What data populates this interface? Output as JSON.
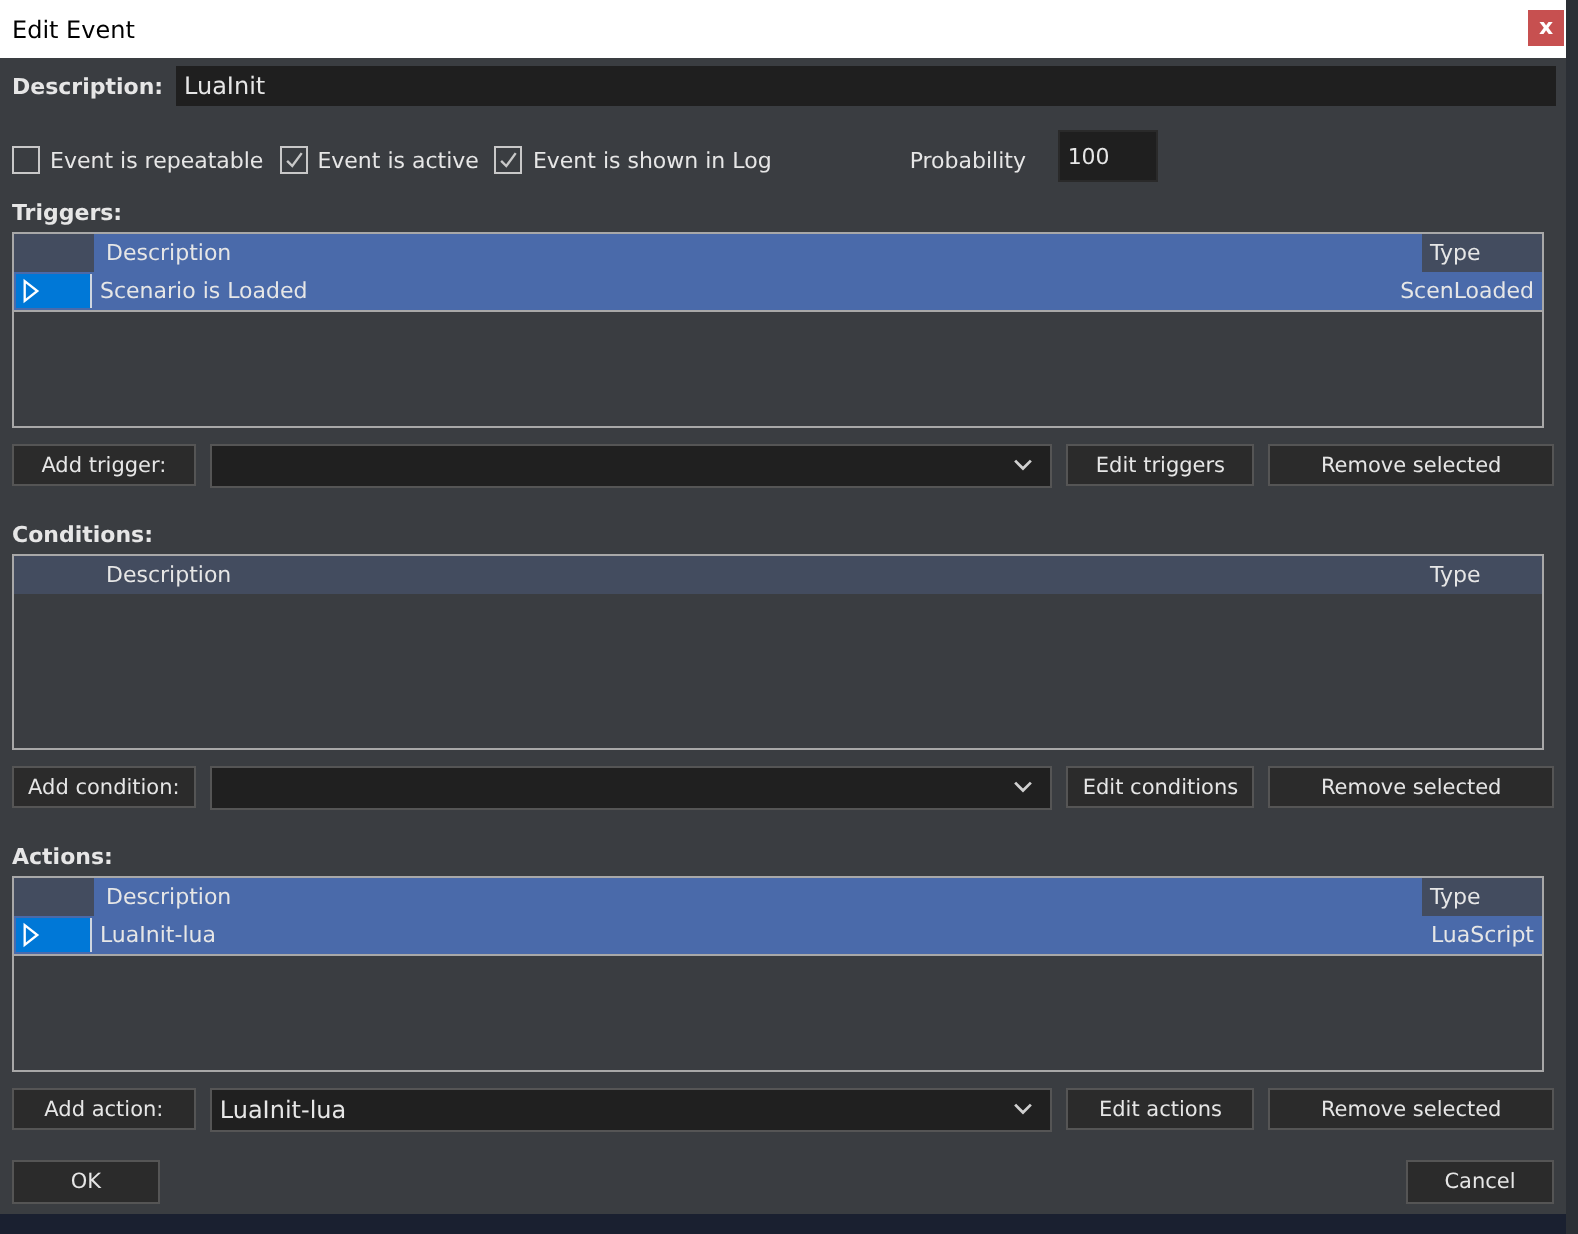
{
  "window": {
    "title": "Edit Event",
    "close_label": "x"
  },
  "description": {
    "label": "Description:",
    "value": "LuaInit"
  },
  "options": [
    {
      "label": "Event is repeatable",
      "checked": false
    },
    {
      "label": "Event is active",
      "checked": true
    },
    {
      "label": "Event is shown in Log",
      "checked": true
    }
  ],
  "probability": {
    "label": "Probability",
    "value": "100"
  },
  "sections": [
    {
      "label": "Triggers:",
      "columns": [
        "Description",
        "Type"
      ],
      "header_selected": true,
      "rows": [
        {
          "description": "Scenario is Loaded",
          "type": "ScenLoaded",
          "selected": true
        }
      ],
      "add_label": "Add trigger:",
      "edit_label": "Edit triggers",
      "remove_label": "Remove selected"
    },
    {
      "label": "Conditions:",
      "columns": [
        "Description",
        "Type"
      ],
      "header_selected": false,
      "add_label": "Add condition:",
      "edit_label": "Edit conditions",
      "remove_label": "Remove selected"
    },
    {
      "label": "Actions:",
      "columns": [
        "Description",
        "Type"
      ],
      "header_selected": true,
      "rows": [
        {
          "description": "LuaInit-lua",
          "type": "LuaScript",
          "selected": true
        }
      ],
      "add_label": "Add action:",
      "combo_value": "LuaInit-lua",
      "edit_label": "Edit actions",
      "remove_label": "Remove selected"
    }
  ],
  "buttons": [
    "OK",
    "Cancel"
  ]
}
